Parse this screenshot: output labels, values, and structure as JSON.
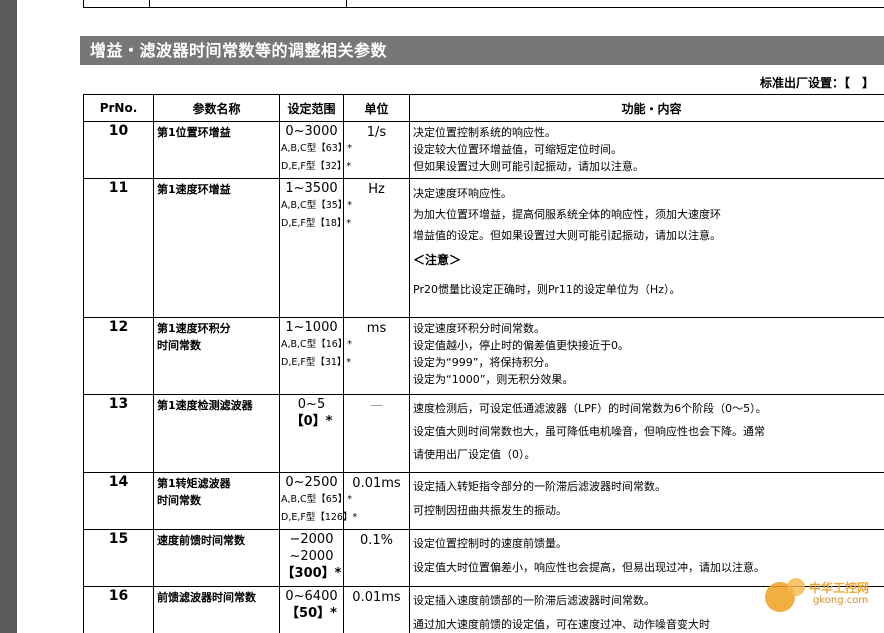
{
  "section_title": "增益・滤波器时间常数等的调整相关参数",
  "default_note": "标准出厂设置：【　】",
  "headers": [
    "PrNo.",
    "参数名称",
    "设定范围",
    "单位",
    "功能・内容"
  ],
  "rows": [
    {
      "no": "10",
      "name": [
        "第1位置环增益"
      ],
      "range_main": "0~3000",
      "range_sub": [
        "A,B,C型【63】*",
        "D,E,F型【32】*"
      ],
      "unit": "1/s",
      "func": [
        "决定位置控制系统的响应性。",
        "设定较大位置环增益值，可缩短定位时间。",
        "但如果设置过大则可能引起振动，请加以注意。"
      ]
    },
    {
      "no": "11",
      "name": [
        "第1速度环增益"
      ],
      "range_main": "1~3500",
      "range_sub": [
        "A,B,C型【35】*",
        "D,E,F型【18】*"
      ],
      "unit": "Hz",
      "func": [
        "决定速度环响应性。",
        "为加大位置环增益，提高伺服系统全体的响应性，须加大速度环",
        "增益值的设定。但如果设置过大则可能引起振动，请加以注意。"
      ],
      "note_heading": "＜注意＞",
      "note": "Pr20惯量比设定正确时，则Pr11的设定单位为（Hz）。"
    },
    {
      "no": "12",
      "name": [
        "第1速度环积分",
        "时间常数"
      ],
      "range_main": "1~1000",
      "range_sub": [
        "A,B,C型【16】*",
        "D,E,F型【31】*"
      ],
      "unit": "ms",
      "func": [
        "设定速度环积分时间常数。",
        "设定值越小，停止时的偏差值更快接近于0。",
        "设定为“999”，将保持积分。",
        "设定为“1000”，则无积分效果。"
      ]
    },
    {
      "no": "13",
      "name": [
        "第1速度检测滤波器"
      ],
      "range_main": "0~5",
      "range_bold": "【0】*",
      "unit": "—",
      "func": [
        "速度检测后，可设定低通滤波器（LPF）的时间常数为6个阶段（0～5）。",
        "设定值大则时间常数也大，虽可降低电机噪音，但响应性也会下降。通常",
        "请使用出厂设定值（0）。"
      ]
    },
    {
      "no": "14",
      "name": [
        "第1转矩滤波器",
        "时间常数"
      ],
      "range_main": "0~2500",
      "range_sub": [
        "A,B,C型【65】*",
        "D,E,F型【126】*"
      ],
      "unit": "0.01ms",
      "func": [
        "设定插入转矩指令部分的一阶滞后滤波器时间常数。",
        "可控制因扭曲共振发生的振动。"
      ]
    },
    {
      "no": "15",
      "name": [
        "速度前馈时间常数"
      ],
      "range_lines": [
        "−2000",
        "~2000"
      ],
      "range_bold": "【300】*",
      "unit": "0.1%",
      "func": [
        "设定位置控制时的速度前馈量。",
        "设定值大时位置偏差小，响应性也会提高，但易出现过冲，请加以注意。"
      ]
    },
    {
      "no": "16",
      "name": [
        "前馈滤波器时间常数"
      ],
      "range_main": "0~6400",
      "range_bold": "【50】*",
      "unit": "0.01ms",
      "func": [
        "设定插入速度前馈部的一阶滞后滤波器时间常数。",
        "通过加大速度前馈的设定值，可在速度过冲、动作噪音变大时"
      ]
    }
  ],
  "watermark": {
    "title": "中华工控网",
    "url": "gkong.com"
  }
}
